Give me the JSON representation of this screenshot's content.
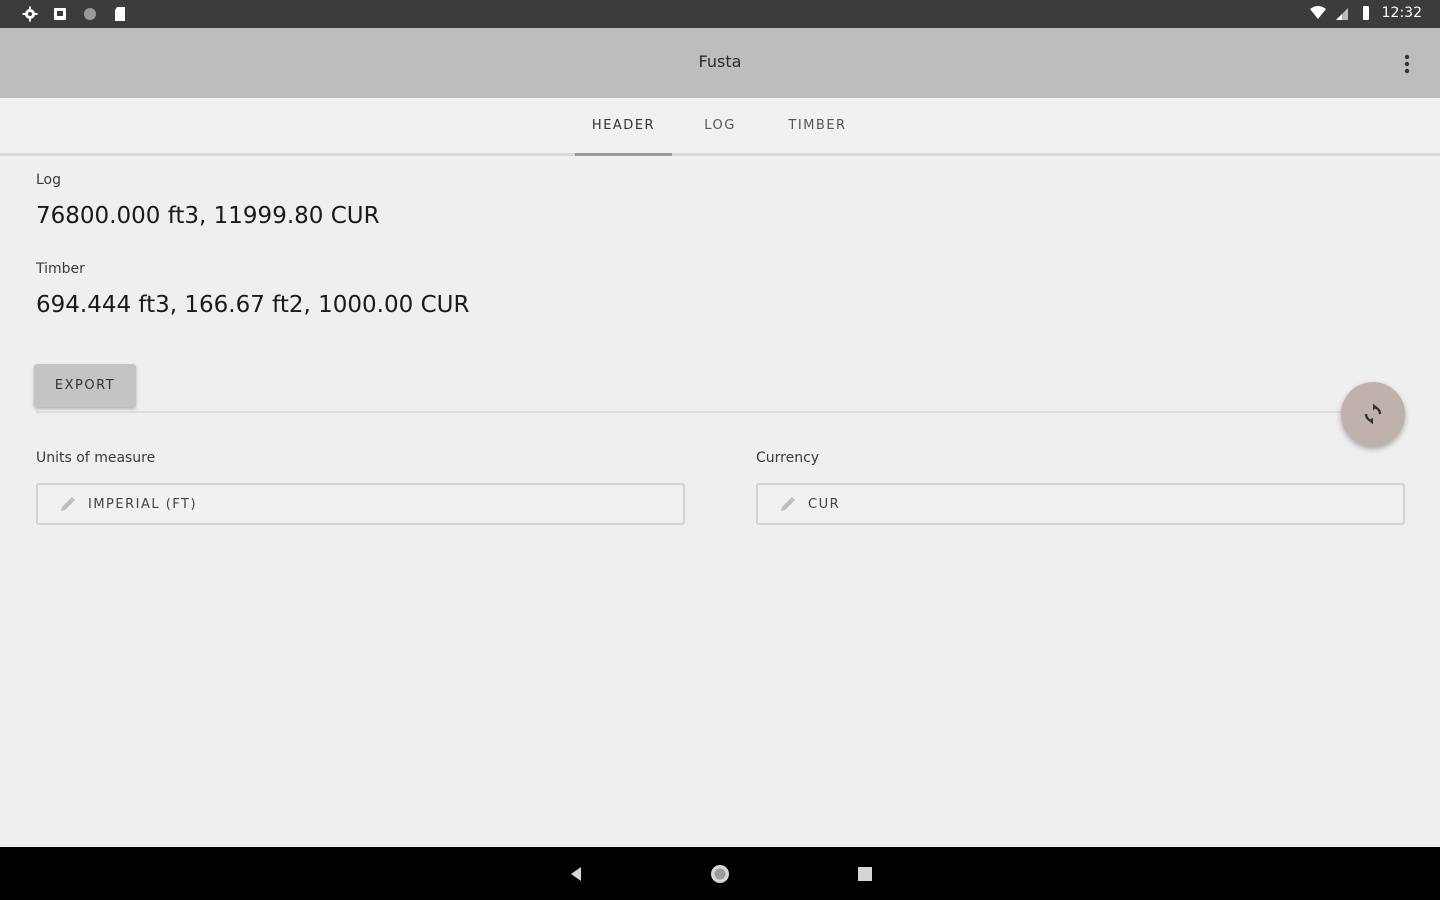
{
  "status_bar": {
    "time": "12:32",
    "left_icons": [
      "settings-icon",
      "notification-icon",
      "circle-icon",
      "sd-card-icon"
    ],
    "right_icons": [
      "wifi-icon",
      "signal-icon",
      "battery-icon"
    ]
  },
  "app_bar": {
    "title": "Fusta",
    "overflow_icon": "more-vert-icon"
  },
  "tabs": [
    {
      "label": "HEADER",
      "active": true
    },
    {
      "label": "LOG",
      "active": false
    },
    {
      "label": "TIMBER",
      "active": false
    }
  ],
  "summary": {
    "log_label": "Log",
    "log_value": "76800.000 ft3, 11999.80 CUR",
    "timber_label": "Timber",
    "timber_value": "694.444 ft3, 166.67 ft2, 1000.00 CUR"
  },
  "actions": {
    "export_label": "EXPORT",
    "fab_icon": "refresh-icon"
  },
  "settings": {
    "units_label": "Units of measure",
    "units_value": "IMPERIAL (FT)",
    "currency_label": "Currency",
    "currency_value": "CUR"
  },
  "nav_bar": {
    "buttons": [
      "back-icon",
      "home-icon",
      "recents-icon"
    ]
  },
  "colors": {
    "app_bar": "#bdbdbd",
    "fab": "#bfb2ad",
    "status_bar": "#3c3c3c",
    "background": "#efefef"
  }
}
